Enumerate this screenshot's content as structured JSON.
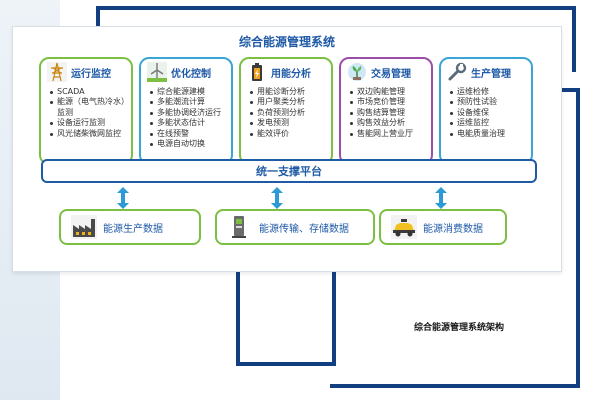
{
  "title": "综合能源管理系统",
  "modules": [
    {
      "label": "运行监控",
      "icon": "power-tower-icon",
      "color": "#7cbf43",
      "items": [
        "SCADA",
        "能源（电气热冷水）监测",
        "设备运行监测",
        "风光储柴微网监控"
      ]
    },
    {
      "label": "优化控制",
      "icon": "wind-turbine-icon",
      "color": "#3aa6d6",
      "items": [
        "综合能源建模",
        "多能潮流计算",
        "多能协调经济运行",
        "多能状态估计",
        "在线预警",
        "电源自动切换"
      ]
    },
    {
      "label": "用能分析",
      "icon": "battery-icon",
      "color": "#7cbf43",
      "items": [
        "用能诊断分析",
        "用户聚类分析",
        "负荷预测分析",
        "发电预测",
        "能效评价"
      ]
    },
    {
      "label": "交易管理",
      "icon": "plant-globe-icon",
      "color": "#9b4fa8",
      "items": [
        "双边购能管理",
        "市场竞价管理",
        "购售结算管理",
        "购售效益分析",
        "售能网上营业厅"
      ]
    },
    {
      "label": "生产管理",
      "icon": "wrench-icon",
      "color": "#3aa6d6",
      "items": [
        "运维检修",
        "预防性试验",
        "设备维保",
        "运维监控",
        "电能质量治理"
      ]
    }
  ],
  "platform": "统一支撑平台",
  "data_sources": [
    {
      "label": "能源生产数据",
      "icon": "factory-icon"
    },
    {
      "label": "能源传输、存储数据",
      "icon": "meter-icon"
    },
    {
      "label": "能源消费数据",
      "icon": "car-icon"
    }
  ],
  "caption": "综合能源管理系统架构",
  "colors": {
    "accent": "#1f5aa6",
    "frame": "#123f80",
    "arrow": "#2b9ad6",
    "green": "#7cbf43"
  }
}
